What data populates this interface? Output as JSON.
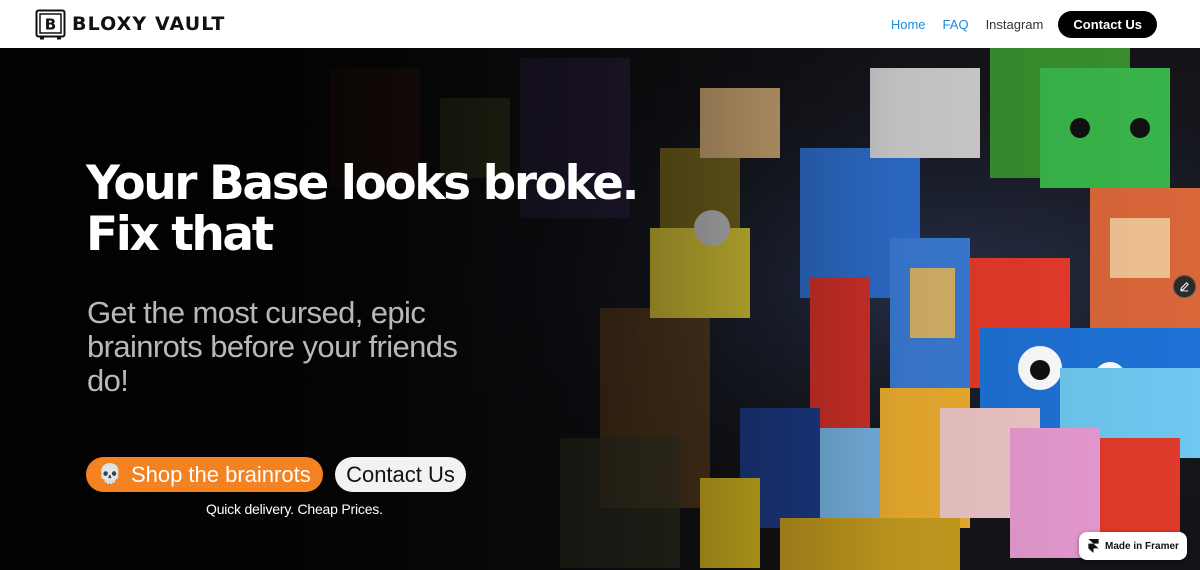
{
  "brand": {
    "logo_letter": "B",
    "name": "BLOXY VAULT"
  },
  "nav": {
    "items": [
      {
        "label": "Home",
        "active": true
      },
      {
        "label": "FAQ",
        "active": true
      },
      {
        "label": "Instagram",
        "active": false
      }
    ],
    "cta_label": "Contact Us"
  },
  "hero": {
    "headline_line1": "Your Base looks broke.",
    "headline_line2": "Fix that",
    "subhead_line1": "Get the most cursed, epic",
    "subhead_line2": "brainrots before your friends",
    "subhead_line3": "do!",
    "shop_button_label": "Shop the brainrots",
    "shop_button_icon": "skull-icon",
    "contact_button_label": "Contact Us",
    "tagline": "Quick delivery. Cheap Prices."
  },
  "badges": {
    "framer_label": "Made in Framer",
    "edit_icon": "pencil-icon"
  },
  "colors": {
    "accent_orange": "#f58220",
    "nav_active_blue": "#1a8cd8",
    "nav_cta_bg": "#000000"
  }
}
